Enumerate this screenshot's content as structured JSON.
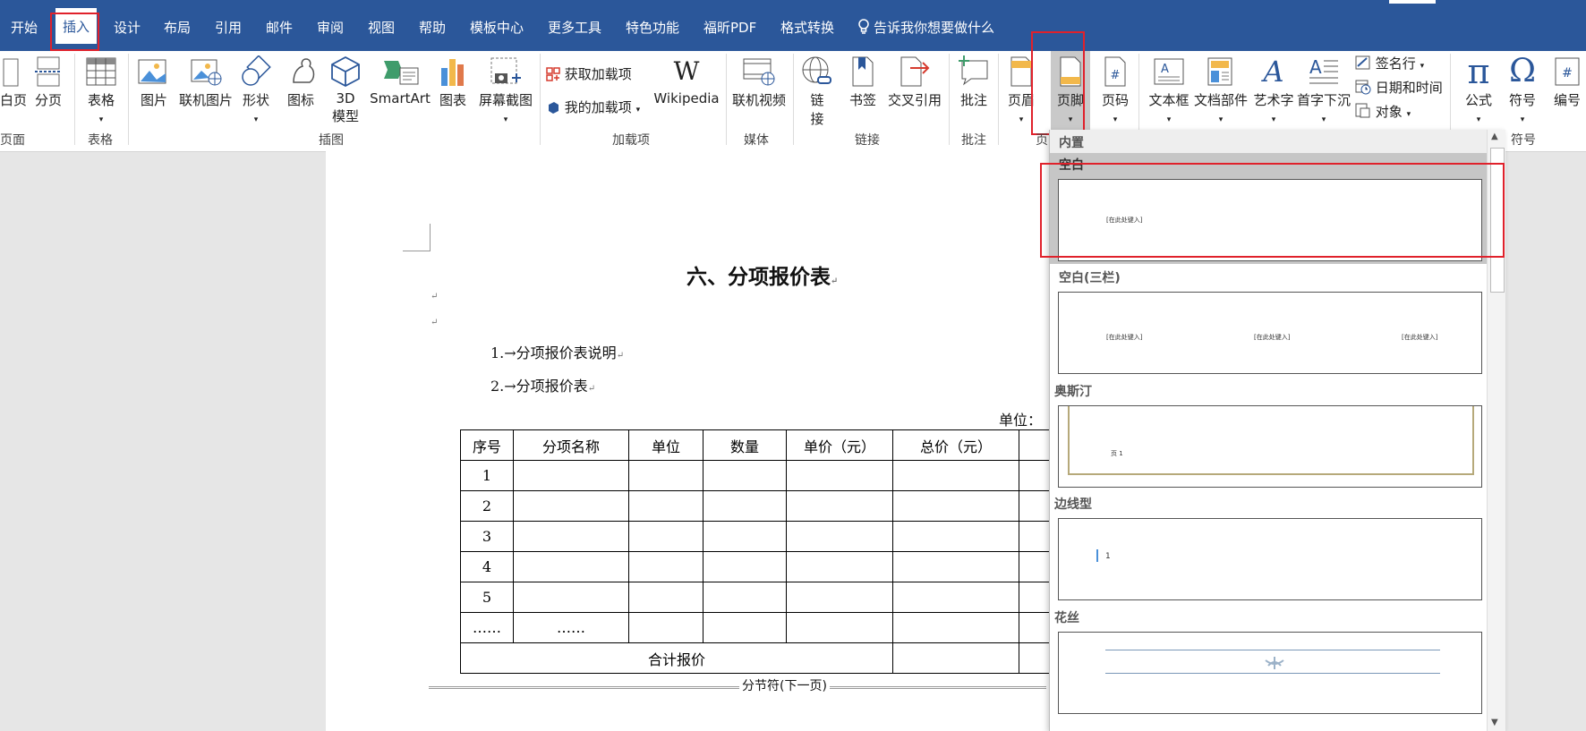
{
  "menu": [
    "开始",
    "插入",
    "设计",
    "布局",
    "引用",
    "邮件",
    "审阅",
    "视图",
    "帮助",
    "模板中心",
    "更多工具",
    "特色功能",
    "福昕PDF",
    "格式转换"
  ],
  "tell_me": "告诉我你想要做什么",
  "ribbon": {
    "page_group": {
      "blank_page": "白页",
      "page_break": "分页",
      "label": "页面"
    },
    "table_group": {
      "table": "表格",
      "label": "表格"
    },
    "illustrations": {
      "picture": "图片",
      "online_picture": "联机图片",
      "shapes": "形状",
      "icons": "图标",
      "model3d_1": "3D",
      "model3d_2": "模型",
      "smartart": "SmartArt",
      "chart": "图表",
      "screenshot": "屏幕截图",
      "label": "插图"
    },
    "addins": {
      "get": "获取加载项",
      "my": "我的加载项",
      "wikipedia": "Wikipedia",
      "label": "加载项"
    },
    "media": {
      "online_video": "联机视频",
      "label": "媒体"
    },
    "links": {
      "link_1": "链",
      "link_2": "接",
      "bookmark": "书签",
      "crossref": "交叉引用",
      "label": "链接"
    },
    "comments": {
      "comment": "批注",
      "label": "批注"
    },
    "header_footer": {
      "header": "页眉",
      "footer": "页脚",
      "page_number": "页码",
      "label": "页"
    },
    "text": {
      "textbox": "文本框",
      "quick_parts": "文档部件",
      "wordart": "艺术字",
      "dropcap": "首字下沉",
      "signature": "签名行",
      "datetime": "日期和时间",
      "object": "对象"
    },
    "symbols": {
      "equation": "公式",
      "symbol": "符号",
      "number": "编号",
      "label": "符号"
    }
  },
  "document": {
    "title": "六、分项报价表",
    "list": [
      "1.→分项报价表说明",
      "2.→分项报价表"
    ],
    "unit": "单位：",
    "table_headers": [
      "序号",
      "分项名称",
      "单位",
      "数量",
      "单价（元）",
      "总价（元）"
    ],
    "rows": [
      "1",
      "2",
      "3",
      "4",
      "5",
      "……"
    ],
    "row6_name": "……",
    "total": "合计报价",
    "section_break": "分节符(下一页)"
  },
  "footer_gallery": {
    "section": "内置",
    "items": [
      {
        "name": "空白",
        "placeholder": "[在此处键入]"
      },
      {
        "name": "空白(三栏)",
        "placeholder": "[在此处键入]"
      },
      {
        "name": "奥斯汀",
        "page": "页 1"
      },
      {
        "name": "边线型",
        "page": "1"
      },
      {
        "name": "花丝"
      }
    ]
  }
}
